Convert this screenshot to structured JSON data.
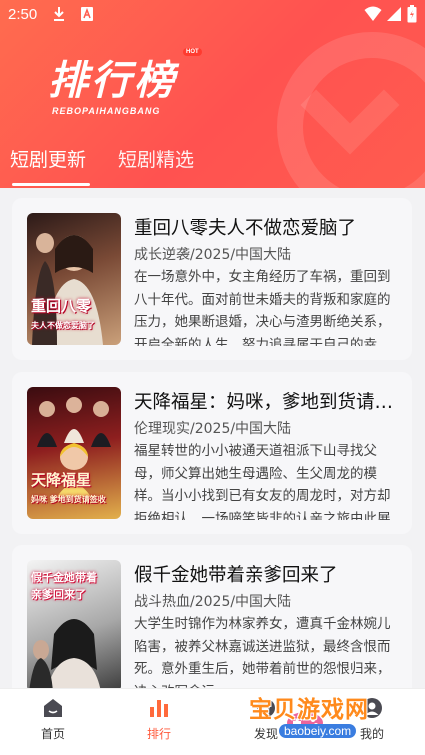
{
  "status_bar": {
    "time": "2:50",
    "icons": [
      "download-icon",
      "a-icon",
      "wifi-icon",
      "signal-icon",
      "battery-icon"
    ]
  },
  "header": {
    "title": "排行榜",
    "badge": "HOT",
    "subtitle": "REBOPAIHANGBANG",
    "colors": {
      "start": "#ff6c4f",
      "end": "#ff5250"
    }
  },
  "tabs": [
    {
      "label": "短剧更新",
      "active": true
    },
    {
      "label": "短剧精选",
      "active": false
    }
  ],
  "dramas": [
    {
      "title": "重回八零夫人不做恋爱脑了",
      "meta": "成长逆袭/2025/中国大陆",
      "desc": "在一场意外中，女主角经历了车祸，重回到八十年代。面对前世未婚夫的背叛和家庭的压力，她果断退婚，决心与渣男断绝关系，开启全新的人生，努力追寻属于自己的幸福。",
      "cover_text": "重回八零",
      "cover_sub": "夫人不做恋爱脑了",
      "cover_colors": [
        "#6a3a2a",
        "#c7a27c"
      ]
    },
    {
      "title": "天降福星：妈咪，爹地到货请签收",
      "meta": "伦理现实/2025/中国大陆",
      "desc": "福星转世的小小被通天道祖派下山寻找父母，师父算出她生母遇险、生父周龙的模样。当小小找到已有女友的周龙时，对方却拒绝相认，一场啼笑皆非的认亲之旅由此展开。",
      "cover_text": "天降福星",
      "cover_sub": "妈咪 爹地到货请签收",
      "cover_colors": [
        "#8a1c1c",
        "#d9a44a"
      ]
    },
    {
      "title": "假千金她带着亲爹回来了",
      "meta": "战斗热血/2025/中国大陆",
      "desc": "大学生时锦作为林家养女，遭真千金林婉儿陷害，被养父林嘉诚送进监狱，最终含恨而死。意外重生后，她带着前世的怨恨归来，决心改写命运。",
      "cover_text": "假千金她带着",
      "cover_sub": "亲爹回来了",
      "cover_colors": [
        "#3a3a3a",
        "#bfbfbf"
      ]
    }
  ],
  "bottom_nav": [
    {
      "label": "首页",
      "icon": "home-icon",
      "active": false
    },
    {
      "label": "排行",
      "icon": "chart-bars-icon",
      "active": true
    },
    {
      "label": "发现",
      "icon": "discover-icon",
      "active": false
    },
    {
      "label": "我的",
      "icon": "profile-icon",
      "active": false
    }
  ],
  "watermark": {
    "text": "宝贝游戏网",
    "url": "baobeiy.com"
  },
  "accent_color": "#ff5a3c"
}
